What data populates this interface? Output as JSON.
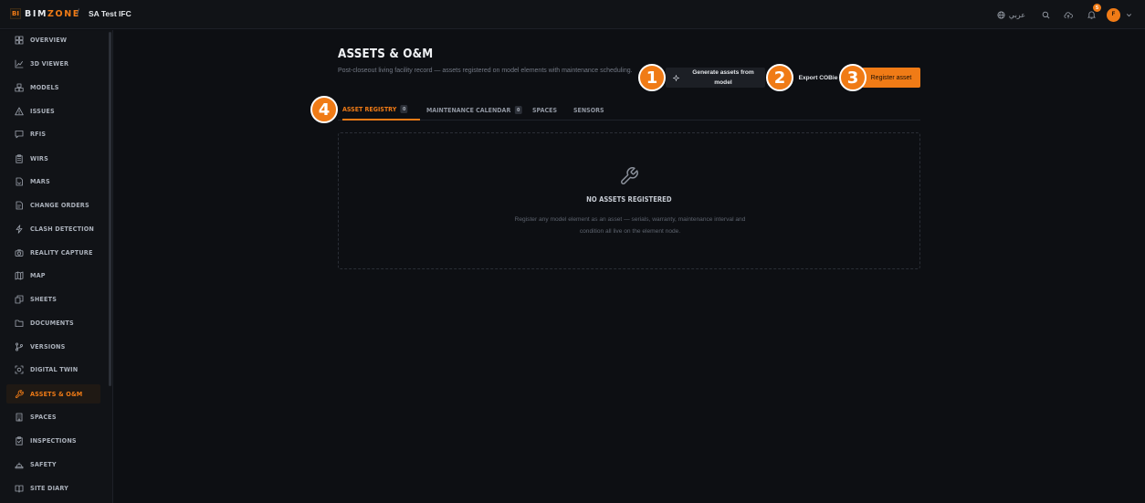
{
  "app": {
    "logo_badge": "BI",
    "logo_text_1": "BIM",
    "logo_text_2": "ZONE",
    "breadcrumb_sep": "/",
    "project_name": "SA Test IFC",
    "accent_color": "#f07b16"
  },
  "topbar": {
    "language_label": "عربي",
    "notification_count": "5",
    "avatar_initial": "F"
  },
  "sidebar": {
    "items": [
      {
        "label": "OVERVIEW",
        "icon": "grid-icon"
      },
      {
        "label": "3D VIEWER",
        "icon": "chart-icon"
      },
      {
        "label": "MODELS",
        "icon": "boxes-icon"
      },
      {
        "label": "ISSUES",
        "icon": "warning-icon"
      },
      {
        "label": "RFIS",
        "icon": "message-icon"
      },
      {
        "label": "WIRS",
        "icon": "clipboard-icon"
      },
      {
        "label": "MARS",
        "icon": "document-arrow-icon"
      },
      {
        "label": "CHANGE ORDERS",
        "icon": "edit-document-icon"
      },
      {
        "label": "CLASH DETECTION",
        "icon": "lightning-icon"
      },
      {
        "label": "REALITY CAPTURE",
        "icon": "camera-icon"
      },
      {
        "label": "MAP",
        "icon": "map-icon"
      },
      {
        "label": "SHEETS",
        "icon": "sheets-icon"
      },
      {
        "label": "DOCUMENTS",
        "icon": "folder-icon"
      },
      {
        "label": "VERSIONS",
        "icon": "git-branch-icon"
      },
      {
        "label": "DIGITAL TWIN",
        "icon": "scan-icon"
      },
      {
        "label": "ASSETS & O&M",
        "icon": "wrench-icon",
        "active": true
      },
      {
        "label": "SPACES",
        "icon": "building-icon"
      },
      {
        "label": "INSPECTIONS",
        "icon": "clipboard-check-icon"
      },
      {
        "label": "SAFETY",
        "icon": "hard-hat-icon"
      },
      {
        "label": "SITE DIARY",
        "icon": "book-icon"
      }
    ]
  },
  "main": {
    "title": "ASSETS & O&M",
    "subtitle": "Post-closeout living facility record — assets registered on model elements with maintenance scheduling.",
    "buttons": {
      "generate": "Generate assets from model",
      "export": "Export COBie",
      "register": "Register asset"
    },
    "callouts": [
      "1",
      "2",
      "3",
      "4"
    ],
    "tabs": [
      {
        "label": "ASSET REGISTRY",
        "count": "0",
        "active": true
      },
      {
        "label": "MAINTENANCE CALENDAR",
        "count": "0"
      },
      {
        "label": "SPACES"
      },
      {
        "label": "SENSORS"
      }
    ],
    "empty_state": {
      "icon": "wrench-icon",
      "title": "NO ASSETS REGISTERED",
      "description": "Register any model element as an asset — serials, warranty, maintenance interval and condition all live on the element node."
    }
  }
}
